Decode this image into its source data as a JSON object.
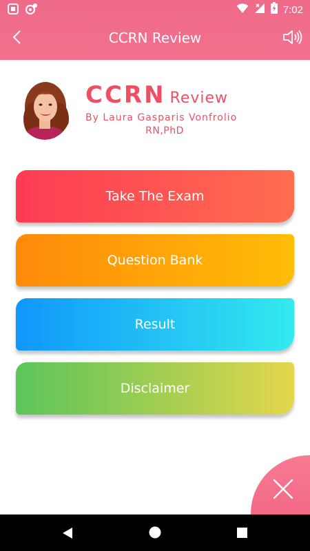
{
  "status_bar": {
    "time": "7:02",
    "icons": [
      "notification-icon",
      "app-notification-icon",
      "wifi-icon",
      "signal-no-data-icon",
      "battery-charging-icon"
    ]
  },
  "app_bar": {
    "title": "CCRN Review",
    "back_icon": "back-arrow-icon",
    "sound_icon": "speaker-icon"
  },
  "header": {
    "brand_main": "CCRN",
    "brand_sub": "Review",
    "author": "By Laura Gasparis Vonfrolio",
    "credentials": "RN,PhD",
    "accent_color": "#ee4f65"
  },
  "menu": {
    "take_exam": "Take The Exam",
    "question_bank": "Question Bank",
    "result": "Result",
    "disclaimer": "Disclaimer"
  },
  "fab": {
    "icon": "close-icon"
  },
  "nav_bar": {
    "icons": [
      "nav-back-icon",
      "nav-home-icon",
      "nav-recents-icon"
    ]
  }
}
